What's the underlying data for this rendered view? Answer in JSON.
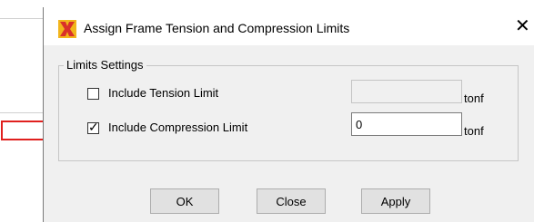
{
  "window": {
    "title": "Assign Frame Tension and Compression Limits",
    "close_symbol": "✕"
  },
  "limits_settings": {
    "legend": "Limits Settings",
    "tension": {
      "label": "Include Tension Limit",
      "checked": false,
      "value": "",
      "enabled": false,
      "unit": "tonf"
    },
    "compression": {
      "label": "Include Compression Limit",
      "checked": true,
      "value": "0",
      "enabled": true,
      "unit": "tonf"
    }
  },
  "buttons": {
    "ok": "OK",
    "close": "Close",
    "apply": "Apply"
  },
  "colors": {
    "annotation_arrow": "#e0201e",
    "dialog_bg": "#f0f0f0",
    "titlebar_bg": "#ffffff",
    "icon_red": "#d9302a",
    "icon_yellow": "#f2b51c"
  },
  "icons": {
    "app": "sap-app-icon",
    "annotation": "red-outline-arrow"
  }
}
